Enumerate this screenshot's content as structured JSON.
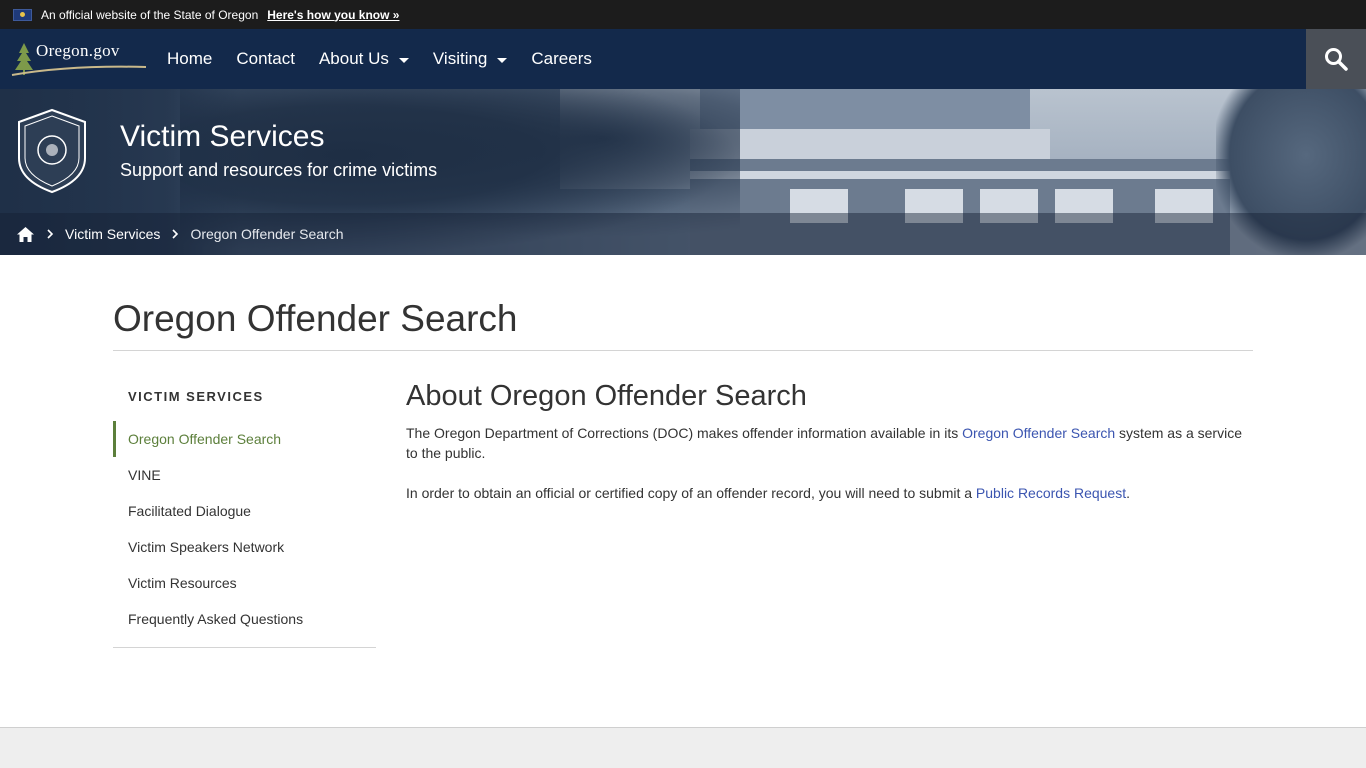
{
  "official": {
    "text": "An official website of the State of Oregon",
    "link": "Here's how you know »"
  },
  "nav": {
    "logo": "Oregon.gov",
    "items": [
      {
        "label": "Home"
      },
      {
        "label": "Contact"
      },
      {
        "label": "About Us"
      },
      {
        "label": "Visiting"
      },
      {
        "label": "Careers"
      }
    ],
    "search_icon": "search-icon"
  },
  "hero": {
    "title": "Victim Services",
    "subtitle": "Support and resources for crime victims",
    "seal_icon": "oregon-doc-seal"
  },
  "breadcrumb": {
    "home_icon": "home-icon",
    "items": [
      "Victim Services",
      "Oregon Offender Search"
    ]
  },
  "page": {
    "title": "Oregon Offender Search"
  },
  "sidenav": {
    "heading": "VICTIM SERVICES",
    "items": [
      {
        "label": "Oregon Offender Search"
      },
      {
        "label": "VINE"
      },
      {
        "label": "Facilitated Dialogue"
      },
      {
        "label": "Victim Speakers Network"
      },
      {
        "label": "Victim Resources"
      },
      {
        "label": "Frequently Asked Questions"
      }
    ]
  },
  "content": {
    "heading": "About Oregon Offender Search",
    "p1_before": "The Oregon Department of Corrections (DOC) makes offender information available in its ",
    "p1_link": "Oregon Offender Search",
    "p1_after": " system as a service to the public.",
    "p2_before": "In order to obtain an official or certified copy of an offender record, you will need to submit a ",
    "p2_link": "Public Records Request",
    "p2_after": "."
  },
  "colors": {
    "nav_bg": "#13294b",
    "active_green": "#5c7f3b",
    "link_blue": "#3b55b0"
  }
}
